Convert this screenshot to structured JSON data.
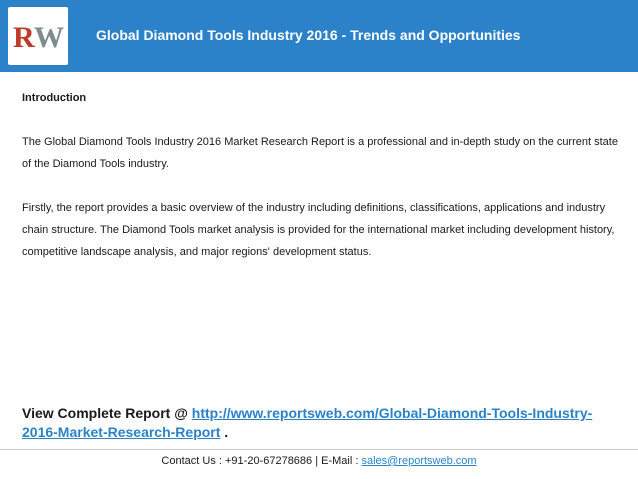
{
  "header": {
    "logo_text": "RW",
    "title": "Global Diamond Tools Industry 2016 - Trends and Opportunities"
  },
  "body": {
    "section_title": "Introduction",
    "paragraphs": [
      "The Global Diamond Tools Industry 2016 Market Research Report is a professional and in-depth study on the current state of the Diamond Tools industry.",
      "Firstly, the report provides a basic overview of the industry including definitions, classifications, applications and industry chain structure. The Diamond Tools market analysis is provided for the international market including development history, competitive landscape analysis, and major regions' development status."
    ]
  },
  "cta": {
    "prefix": "View Complete Report @ ",
    "link_text": "http://www.reportsweb.com/Global-Diamond-Tools-Industry-2016-Market-Research-Report",
    "suffix": " ."
  },
  "footer": {
    "contact_prefix": "Contact Us : +91-20-67278686 | E-Mail : ",
    "email": "sales@reportsweb.com"
  },
  "colors": {
    "accent": "#2c82c9",
    "logo_red": "#c0392b",
    "logo_gray": "#7f8c8d"
  }
}
